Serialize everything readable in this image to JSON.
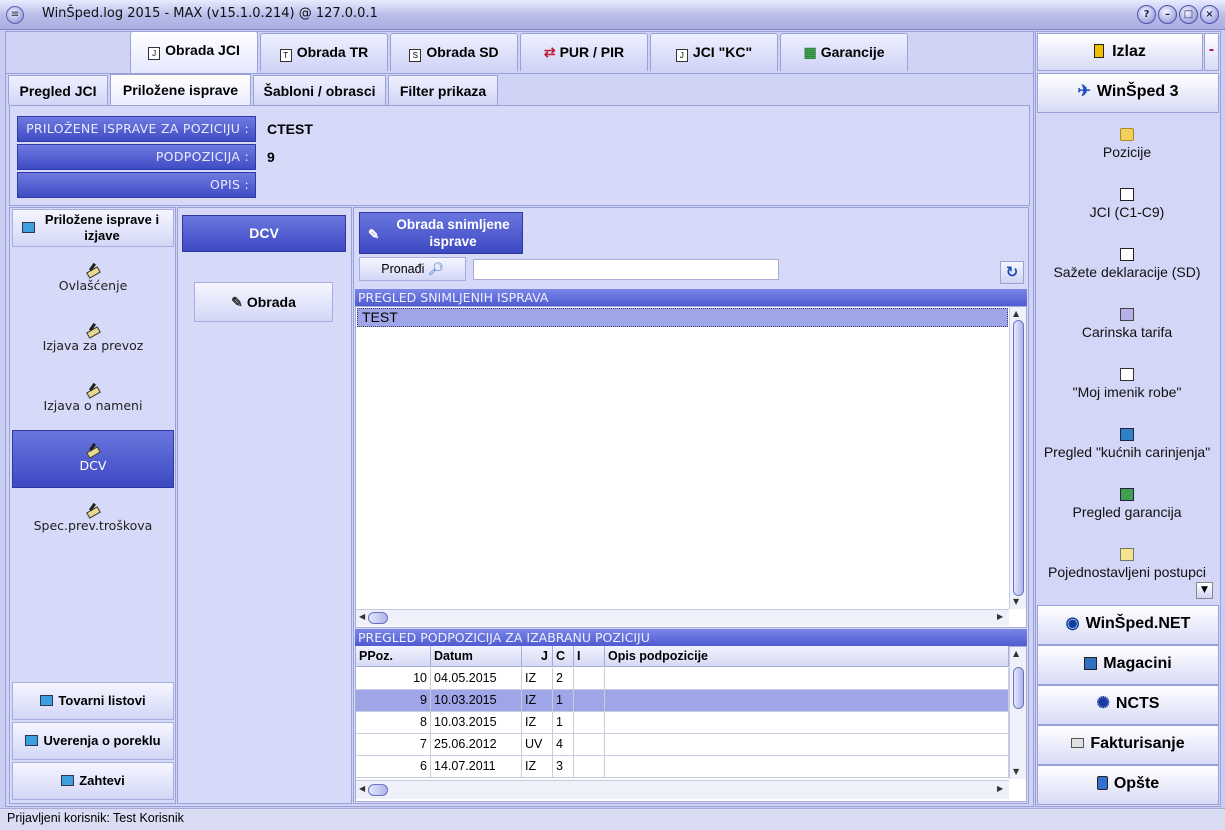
{
  "window": {
    "title": "WinŠped.log 2015 - MAX (v15.1.0.214) @ 127.0.0.1"
  },
  "main_tabs": [
    {
      "label": "Obrada JCI",
      "active": true
    },
    {
      "label": "Obrada TR"
    },
    {
      "label": "Obrada SD"
    },
    {
      "label": "PUR / PIR"
    },
    {
      "label": "JCI \"KC\""
    },
    {
      "label": "Garancije"
    }
  ],
  "sub_tabs": [
    {
      "label": "Pregled JCI"
    },
    {
      "label": "Priložene isprave",
      "active": true
    },
    {
      "label": "Šabloni / obrasci"
    },
    {
      "label": "Filter prikaza"
    }
  ],
  "header_fields": {
    "pozicija_label": "PRILOŽENE ISPRAVE ZA POZICIJU :",
    "pozicija_value": "CTEST",
    "podpozicija_label": "PODPOZICIJA :",
    "podpozicija_value": "9",
    "opis_label": "OPIS :",
    "opis_value": ""
  },
  "left_nav": {
    "header": "Priložene isprave i izjave",
    "items": [
      {
        "label": "Ovlašćenje"
      },
      {
        "label": "Izjava za prevoz"
      },
      {
        "label": "Izjava o nameni"
      },
      {
        "label": "DCV",
        "active": true
      },
      {
        "label": "Spec.prev.troškova"
      }
    ],
    "bottom_buttons": [
      {
        "label": "Tovarni listovi"
      },
      {
        "label": "Uverenja o poreklu"
      },
      {
        "label": "Zahtevi"
      }
    ]
  },
  "mid": {
    "header": "DCV",
    "obrada_button": "Obrada"
  },
  "content": {
    "obrada_snimljene_button": "Obrada snimljene isprave",
    "find_button": "Pronađi",
    "search_value": "",
    "list_header": "PREGLED SNIMLJENIH ISPRAVA",
    "list_items": [
      "TEST"
    ],
    "sub_header": "PREGLED PODPOZICIJA ZA IZABRANU POZICIJU",
    "columns": [
      "PPoz.",
      "Datum",
      "J",
      "C",
      "I",
      "Opis podpozicije"
    ],
    "rows": [
      {
        "ppoz": "10",
        "datum": "04.05.2015",
        "j": "IZ",
        "c": "2",
        "i": "",
        "opis": ""
      },
      {
        "ppoz": "9",
        "datum": "10.03.2015",
        "j": "IZ",
        "c": "1",
        "i": "",
        "opis": "",
        "selected": true
      },
      {
        "ppoz": "8",
        "datum": "10.03.2015",
        "j": "IZ",
        "c": "1",
        "i": "",
        "opis": ""
      },
      {
        "ppoz": "7",
        "datum": "25.06.2012",
        "j": "UV",
        "c": "4",
        "i": "",
        "opis": ""
      },
      {
        "ppoz": "6",
        "datum": "14.07.2011",
        "j": "IZ",
        "c": "3",
        "i": "",
        "opis": ""
      }
    ]
  },
  "right_panel": {
    "izlaz": "Izlaz",
    "winsped3": "WinŠped 3",
    "items": [
      {
        "label": "Pozicije"
      },
      {
        "label": "JCI (C1-C9)"
      },
      {
        "label": "Sažete deklaracije (SD)"
      },
      {
        "label": "Carinska tarifa"
      },
      {
        "label": "\"Moj imenik robe\""
      },
      {
        "label": "Pregled \"kućnih carinjenja\""
      },
      {
        "label": "Pregled garancija"
      },
      {
        "label": "Pojednostavljeni postupci"
      }
    ],
    "bottom_buttons": [
      {
        "label": "WinŠped.NET"
      },
      {
        "label": "Magacini"
      },
      {
        "label": "NCTS"
      },
      {
        "label": "Fakturisanje"
      },
      {
        "label": "Opšte"
      }
    ]
  },
  "status": {
    "text": "Prijavljeni korisnik: Test Korisnik"
  },
  "colors": {
    "accent": "#4f5bd0",
    "selection": "#9fa6e8",
    "panel": "#d0d4f6"
  }
}
